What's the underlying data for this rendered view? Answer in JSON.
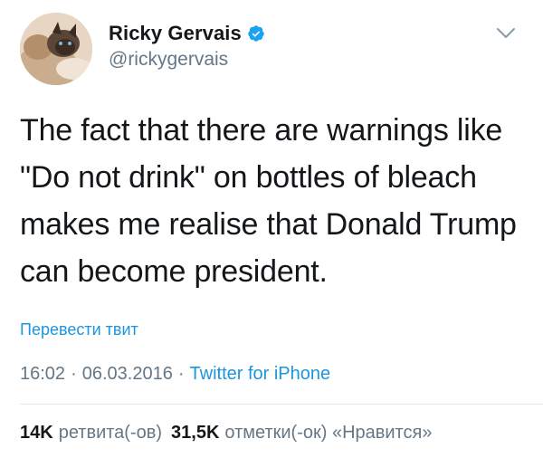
{
  "tweet": {
    "author": {
      "display_name": "Ricky Gervais",
      "handle": "@rickygervais",
      "verified": true,
      "avatar_icon": "avatar-cat-photo"
    },
    "menu_icon": "chevron-down-icon",
    "text_lines": [
      "The fact that there are warnings like",
      "\"Do not drink\" on bottles of bleach",
      "makes me realise that Donald Trump",
      "can become president."
    ],
    "translate_label": "Перевести твит",
    "meta": {
      "time": "16:02",
      "date": "06.03.2016",
      "separator": "·",
      "source": "Twitter for iPhone"
    },
    "stats": {
      "retweets_count": "14K",
      "retweets_label": "ретвита(-ов)",
      "likes_count": "31,5K",
      "likes_label": "отметки(-ок) «Нравится»"
    }
  },
  "colors": {
    "text_primary": "#14171a",
    "text_secondary": "#657786",
    "link": "#1b95e0",
    "verified": "#1da1f2",
    "divider": "#e1e8ed"
  }
}
